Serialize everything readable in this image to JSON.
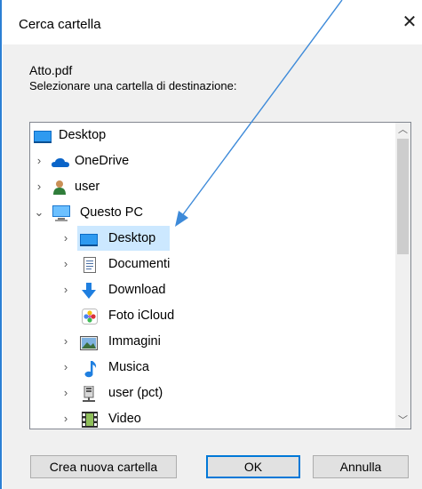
{
  "dialog": {
    "title": "Cerca cartella",
    "close_glyph": "✕",
    "file_name": "Atto.pdf",
    "instruction": "Selezionare una cartella di destinazione:"
  },
  "tree": {
    "items": [
      {
        "label": "Desktop",
        "icon": "desktop-icon",
        "expander": ""
      },
      {
        "label": "OneDrive",
        "icon": "onedrive-icon",
        "expander": "›"
      },
      {
        "label": "user",
        "icon": "user-icon",
        "expander": "›"
      },
      {
        "label": "Questo PC",
        "icon": "pc-icon",
        "expander": "⌄"
      },
      {
        "label": "Desktop",
        "icon": "desktop-icon",
        "expander": "›",
        "selected": true
      },
      {
        "label": "Documenti",
        "icon": "documents-icon",
        "expander": "›"
      },
      {
        "label": "Download",
        "icon": "download-icon",
        "expander": "›"
      },
      {
        "label": "Foto iCloud",
        "icon": "icloud-photos-icon",
        "expander": ""
      },
      {
        "label": "Immagini",
        "icon": "pictures-icon",
        "expander": "›"
      },
      {
        "label": "Musica",
        "icon": "music-icon",
        "expander": "›"
      },
      {
        "label": "user (pct)",
        "icon": "network-drive-icon",
        "expander": "›"
      },
      {
        "label": "Video",
        "icon": "video-icon",
        "expander": "›"
      }
    ]
  },
  "scrollbar": {
    "up_glyph": "︿",
    "down_glyph": "﹀"
  },
  "buttons": {
    "new_folder": "Crea nuova cartella",
    "ok": "OK",
    "cancel": "Annulla"
  },
  "colors": {
    "selection": "#cce8ff",
    "accent": "#0078d7",
    "annotation_arrow": "#3d8ad9"
  }
}
